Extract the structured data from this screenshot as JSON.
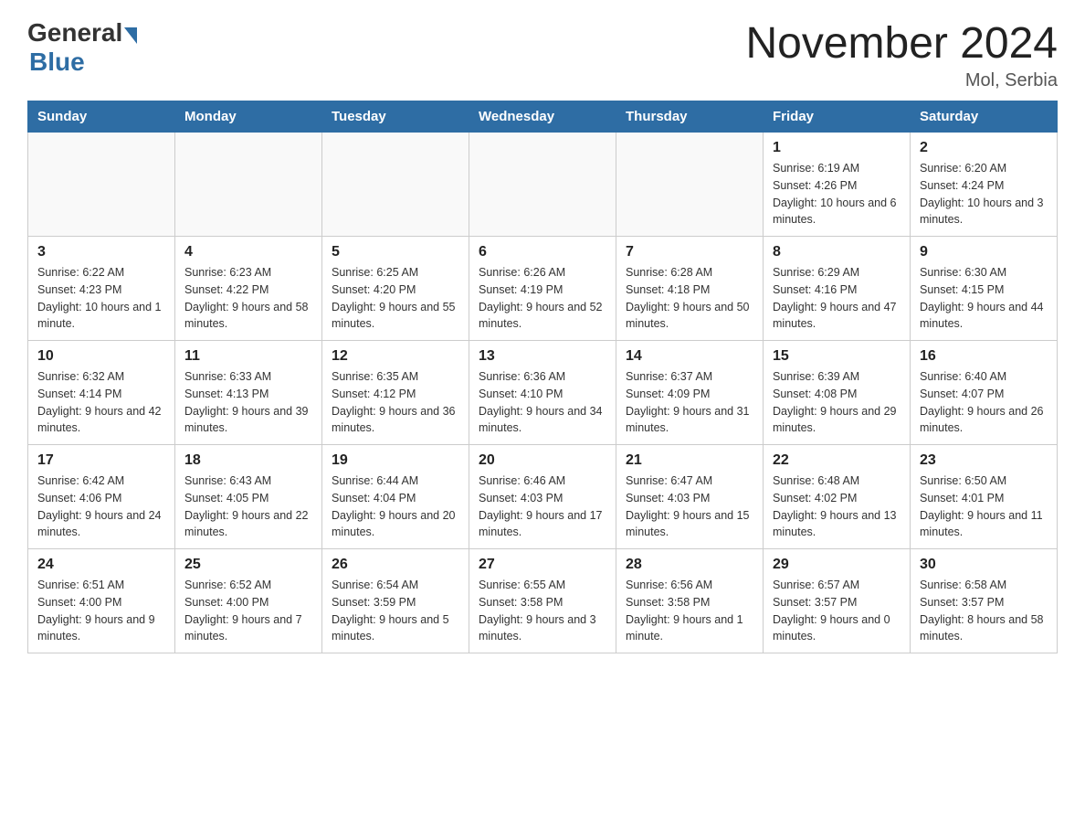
{
  "header": {
    "logo_general": "General",
    "logo_blue": "Blue",
    "month_title": "November 2024",
    "location": "Mol, Serbia"
  },
  "weekdays": [
    "Sunday",
    "Monday",
    "Tuesday",
    "Wednesday",
    "Thursday",
    "Friday",
    "Saturday"
  ],
  "weeks": [
    [
      {
        "day": "",
        "info": ""
      },
      {
        "day": "",
        "info": ""
      },
      {
        "day": "",
        "info": ""
      },
      {
        "day": "",
        "info": ""
      },
      {
        "day": "",
        "info": ""
      },
      {
        "day": "1",
        "info": "Sunrise: 6:19 AM\nSunset: 4:26 PM\nDaylight: 10 hours and 6 minutes."
      },
      {
        "day": "2",
        "info": "Sunrise: 6:20 AM\nSunset: 4:24 PM\nDaylight: 10 hours and 3 minutes."
      }
    ],
    [
      {
        "day": "3",
        "info": "Sunrise: 6:22 AM\nSunset: 4:23 PM\nDaylight: 10 hours and 1 minute."
      },
      {
        "day": "4",
        "info": "Sunrise: 6:23 AM\nSunset: 4:22 PM\nDaylight: 9 hours and 58 minutes."
      },
      {
        "day": "5",
        "info": "Sunrise: 6:25 AM\nSunset: 4:20 PM\nDaylight: 9 hours and 55 minutes."
      },
      {
        "day": "6",
        "info": "Sunrise: 6:26 AM\nSunset: 4:19 PM\nDaylight: 9 hours and 52 minutes."
      },
      {
        "day": "7",
        "info": "Sunrise: 6:28 AM\nSunset: 4:18 PM\nDaylight: 9 hours and 50 minutes."
      },
      {
        "day": "8",
        "info": "Sunrise: 6:29 AM\nSunset: 4:16 PM\nDaylight: 9 hours and 47 minutes."
      },
      {
        "day": "9",
        "info": "Sunrise: 6:30 AM\nSunset: 4:15 PM\nDaylight: 9 hours and 44 minutes."
      }
    ],
    [
      {
        "day": "10",
        "info": "Sunrise: 6:32 AM\nSunset: 4:14 PM\nDaylight: 9 hours and 42 minutes."
      },
      {
        "day": "11",
        "info": "Sunrise: 6:33 AM\nSunset: 4:13 PM\nDaylight: 9 hours and 39 minutes."
      },
      {
        "day": "12",
        "info": "Sunrise: 6:35 AM\nSunset: 4:12 PM\nDaylight: 9 hours and 36 minutes."
      },
      {
        "day": "13",
        "info": "Sunrise: 6:36 AM\nSunset: 4:10 PM\nDaylight: 9 hours and 34 minutes."
      },
      {
        "day": "14",
        "info": "Sunrise: 6:37 AM\nSunset: 4:09 PM\nDaylight: 9 hours and 31 minutes."
      },
      {
        "day": "15",
        "info": "Sunrise: 6:39 AM\nSunset: 4:08 PM\nDaylight: 9 hours and 29 minutes."
      },
      {
        "day": "16",
        "info": "Sunrise: 6:40 AM\nSunset: 4:07 PM\nDaylight: 9 hours and 26 minutes."
      }
    ],
    [
      {
        "day": "17",
        "info": "Sunrise: 6:42 AM\nSunset: 4:06 PM\nDaylight: 9 hours and 24 minutes."
      },
      {
        "day": "18",
        "info": "Sunrise: 6:43 AM\nSunset: 4:05 PM\nDaylight: 9 hours and 22 minutes."
      },
      {
        "day": "19",
        "info": "Sunrise: 6:44 AM\nSunset: 4:04 PM\nDaylight: 9 hours and 20 minutes."
      },
      {
        "day": "20",
        "info": "Sunrise: 6:46 AM\nSunset: 4:03 PM\nDaylight: 9 hours and 17 minutes."
      },
      {
        "day": "21",
        "info": "Sunrise: 6:47 AM\nSunset: 4:03 PM\nDaylight: 9 hours and 15 minutes."
      },
      {
        "day": "22",
        "info": "Sunrise: 6:48 AM\nSunset: 4:02 PM\nDaylight: 9 hours and 13 minutes."
      },
      {
        "day": "23",
        "info": "Sunrise: 6:50 AM\nSunset: 4:01 PM\nDaylight: 9 hours and 11 minutes."
      }
    ],
    [
      {
        "day": "24",
        "info": "Sunrise: 6:51 AM\nSunset: 4:00 PM\nDaylight: 9 hours and 9 minutes."
      },
      {
        "day": "25",
        "info": "Sunrise: 6:52 AM\nSunset: 4:00 PM\nDaylight: 9 hours and 7 minutes."
      },
      {
        "day": "26",
        "info": "Sunrise: 6:54 AM\nSunset: 3:59 PM\nDaylight: 9 hours and 5 minutes."
      },
      {
        "day": "27",
        "info": "Sunrise: 6:55 AM\nSunset: 3:58 PM\nDaylight: 9 hours and 3 minutes."
      },
      {
        "day": "28",
        "info": "Sunrise: 6:56 AM\nSunset: 3:58 PM\nDaylight: 9 hours and 1 minute."
      },
      {
        "day": "29",
        "info": "Sunrise: 6:57 AM\nSunset: 3:57 PM\nDaylight: 9 hours and 0 minutes."
      },
      {
        "day": "30",
        "info": "Sunrise: 6:58 AM\nSunset: 3:57 PM\nDaylight: 8 hours and 58 minutes."
      }
    ]
  ]
}
